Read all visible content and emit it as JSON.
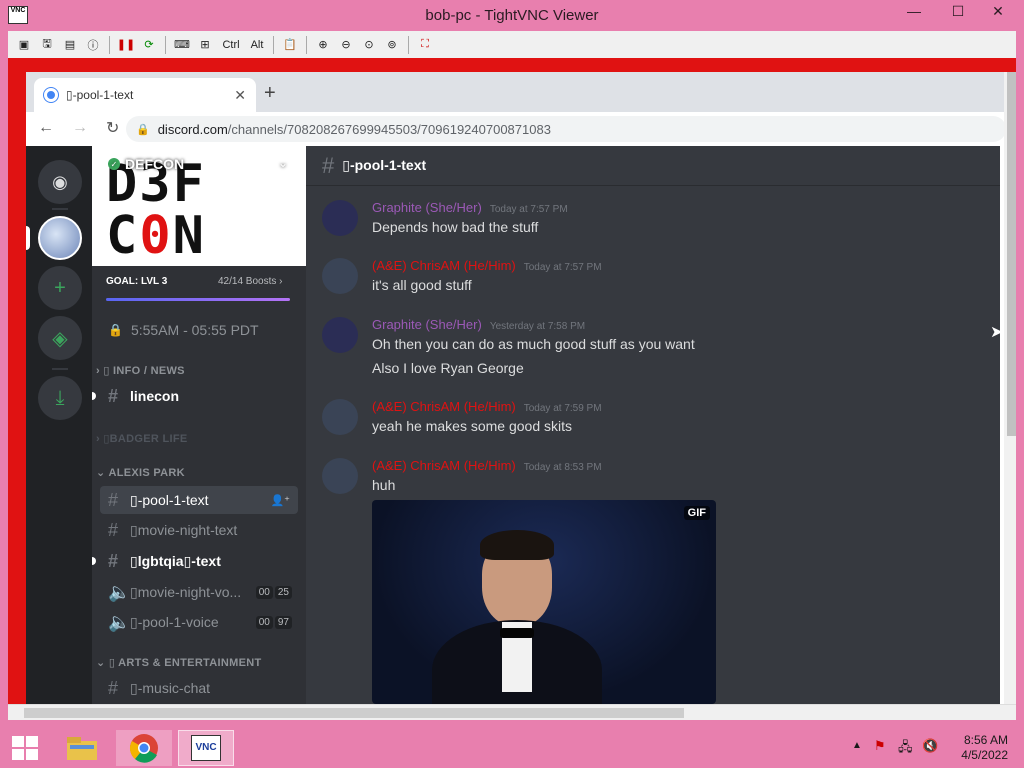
{
  "vnc": {
    "title": "bob-pc - TightVNC Viewer",
    "icon_label": "VNC",
    "toolbar_ctrl": "Ctrl",
    "toolbar_alt": "Alt"
  },
  "browser": {
    "tab_title": "▯-pool-1-text",
    "url_host": "discord.com",
    "url_path": "/channels/708208267699945503/709619240700871083"
  },
  "server": {
    "name": "DEFCON",
    "banner_line1": "D3F",
    "banner_line2_a": "C",
    "banner_line2_zero": "0",
    "banner_line2_b": "N",
    "goal": "GOAL: LVL 3",
    "boosts": "42/14 Boosts",
    "schedule": "5:55AM - 05:55 PDT"
  },
  "categories": {
    "info": "▯ INFO / NEWS",
    "badger": "▯BADGER LIFE",
    "alexis": "ALEXIS PARK",
    "arts": "▯ ARTS & ENTERTAINMENT"
  },
  "channels": {
    "linecon": "linecon",
    "pool_text": "▯-pool-1-text",
    "movie_text": "▯movie-night-text",
    "lgbt_text": "▯lgbtqia▯-text",
    "movie_voice": "▯movie-night-vo...",
    "movie_voice_b1": "00",
    "movie_voice_b2": "25",
    "pool_voice": "▯-pool-1-voice",
    "pool_voice_b1": "00",
    "pool_voice_b2": "97",
    "music_chat": "▯-music-chat"
  },
  "chat": {
    "header": "▯-pool-1-text",
    "messages": [
      {
        "author": "Graphite (She/Her)",
        "time": "Today at 7:57 PM",
        "lines": [
          "Depends how bad the stuff"
        ]
      },
      {
        "author": "(A&E) ChrisAM (He/Him)",
        "time": "Today at 7:57 PM",
        "lines": [
          "it's all good stuff"
        ]
      },
      {
        "author": "Graphite (She/Her)",
        "time": "Yesterday at 7:58 PM",
        "lines": [
          "Oh then you can do as much good stuff as you want",
          "Also I love Ryan George"
        ]
      },
      {
        "author": "(A&E) ChrisAM (He/Him)",
        "time": "Today at 7:59 PM",
        "lines": [
          "yeah he makes some good skits"
        ]
      },
      {
        "author": "(A&E) ChrisAM (He/Him)",
        "time": "Today at 8:53 PM",
        "lines": [
          "huh"
        ]
      }
    ],
    "gif_label": "GIF"
  },
  "taskbar": {
    "time": "8:56 AM",
    "date": "4/5/2022"
  },
  "colors": {
    "accent_pink": "#e87fae",
    "discord_bg": "#36393f",
    "author_purple": "#9b59b6",
    "author_red": "#e01212"
  }
}
